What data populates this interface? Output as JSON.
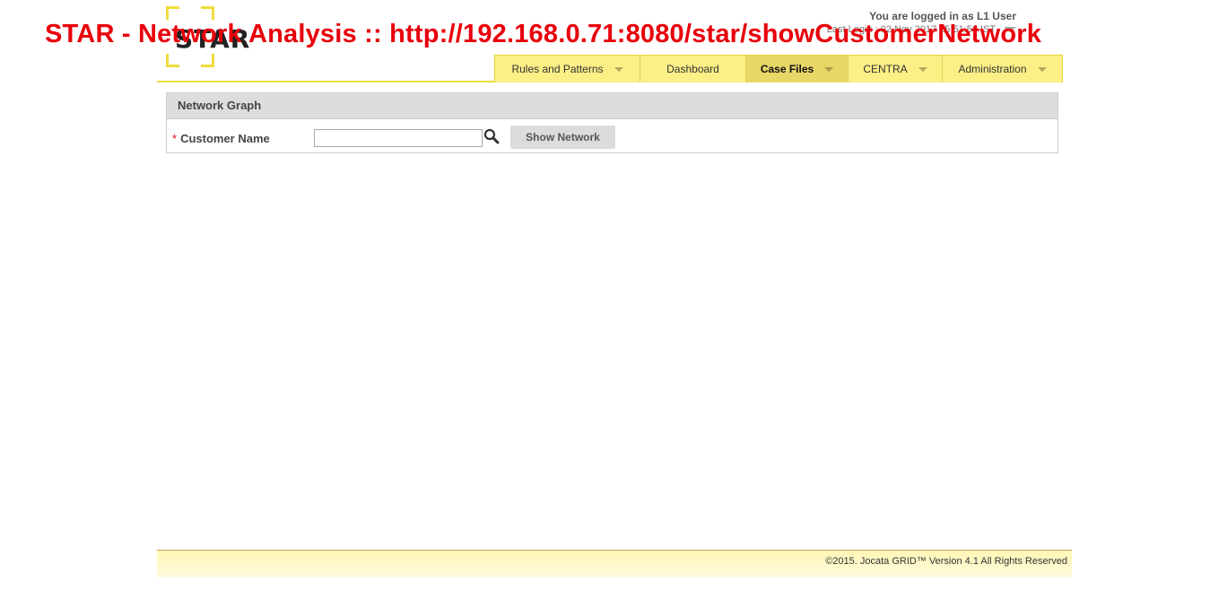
{
  "overlay": {
    "title": "STAR - Network Analysis :: http://192.168.0.71:8080/star/showCustomerNetwork"
  },
  "header": {
    "logo_text": "STAR",
    "logged_in_text": "You are logged in as L1 User",
    "last_login_text": "Last Login : 02 Nov 2017 15:51:50 IST"
  },
  "nav": {
    "items": [
      {
        "label": "Rules and Patterns",
        "has_dropdown": true,
        "active": false
      },
      {
        "label": "Dashboard",
        "has_dropdown": false,
        "active": false
      },
      {
        "label": "Case Files",
        "has_dropdown": true,
        "active": true
      },
      {
        "label": "CENTRA",
        "has_dropdown": true,
        "active": false
      },
      {
        "label": "Administration",
        "has_dropdown": true,
        "active": false
      }
    ]
  },
  "panel": {
    "title": "Network Graph",
    "field_label": "Customer Name",
    "required_marker": "*",
    "customer_name_value": "",
    "button_label": "Show Network"
  },
  "footer": {
    "copyright": "©2015. Jocata GRID™ Version 4.1 All Rights Reserved"
  },
  "colors": {
    "accent_yellow": "#f0dc3c",
    "nav_bg": "#fbef86",
    "nav_active_bg": "#e7d767",
    "overlay_red": "#e8000b"
  }
}
